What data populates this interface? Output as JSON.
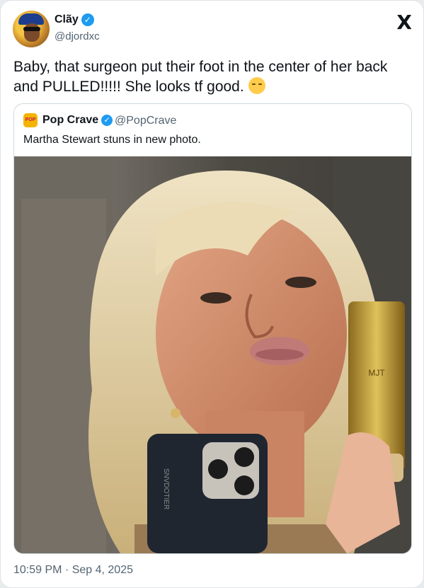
{
  "author": {
    "name": "Clãy",
    "handle": "@djordxc",
    "verified_icon": "verified-badge-icon"
  },
  "platform_logo": "X",
  "tweet": {
    "text": "Baby, that surgeon put their foot in the center of her back and PULLED!!!!! She looks tf good.",
    "emoji": "relieved-face-emoji"
  },
  "quoted": {
    "avatar_text": "POP",
    "name": "Pop Crave",
    "handle": "@PopCrave",
    "text": "Martha Stewart stuns in new photo."
  },
  "photo": {
    "phone_case_text": "SNVDOTIER",
    "bottle_text": "MJT"
  },
  "timestamp": "10:59 PM · Sep 4, 2025",
  "colors": {
    "verified": "#1d9bf0",
    "secondary_text": "#536471",
    "border": "#cfd9de"
  }
}
